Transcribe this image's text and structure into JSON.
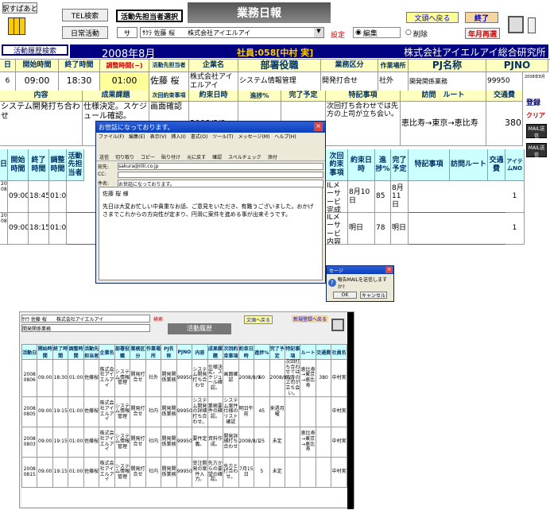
{
  "toolbar": {
    "station_label": "駅すぱあと",
    "tel_search": "TEL検索",
    "assign_select": "活動先担当者選択",
    "title": "業務日報",
    "doc_back": "文頭へ戻る",
    "end": "終了",
    "daily": "日常活動",
    "sa": "サ",
    "customer": "ｻｸﾗ 佐藤 桜　　株式会社アイエルアイ",
    "settings": "設定",
    "edit": "編集",
    "delete": "削除",
    "year_month_reset": "年月再選",
    "history_search": "活動履歴検索"
  },
  "banner": {
    "month": "2008年8月",
    "employee": "社員:058[中村 実]",
    "company": "株式会社アイエルアイ総合研究所"
  },
  "head_row": {
    "labels": [
      "日",
      "開始時間",
      "終了時間",
      "調整時間(−)",
      "活動先担当者",
      "企業名",
      "部署役職",
      "業務区分",
      "作業場所",
      "PJ名称",
      "PJNO"
    ],
    "values": [
      "6",
      "09:00",
      "18:30",
      "01:00",
      "佐藤 桜",
      "株式会社アイエルアイ",
      "システム情報管理",
      "開発打合せ",
      "社外",
      "開発関係業務",
      "99950"
    ],
    "side": "2008年8月"
  },
  "detail_row": {
    "labels": [
      "内容",
      "成果課題",
      "次回約束事項",
      "約束日時",
      "進捗%",
      "完了予定",
      "特記事項",
      "訪問　ルート",
      "交通費"
    ],
    "content": "システム開発打ち合わせ",
    "result": "仕様決定。スケジュール確認。",
    "next_promise": "画面確認",
    "promise_date": "2008/8/9",
    "note": "次回打ち合わせでは先方の上司が立ち会い。",
    "route": "恵比寿→東京→恵比寿",
    "fare": "380"
  },
  "side_buttons": [
    "登録",
    "クリア",
    "MAIL送信",
    "MAIL送信"
  ],
  "lower_table": {
    "headers": [
      "日",
      "開始時間",
      "終了時間",
      "調整時間",
      "活動先担当者",
      "次回約束事項",
      "約束日時",
      "進捗%",
      "完了予定",
      "特記事項",
      "訪問ルート",
      "交通費",
      "アイテムNO"
    ],
    "rows": [
      {
        "date": "2008 0805",
        "start": "09:00",
        "end": "18:45",
        "adj": "01:00",
        "next": "ILメーサービ完成",
        "promise": "8月10日",
        "progress": "85",
        "done": "8月11日",
        "item": "1"
      },
      {
        "date": "2008 0804",
        "start": "09:00",
        "end": "18:15",
        "adj": "01:00",
        "next": "ILメーサービ内容確認",
        "promise": "明日",
        "progress": "78",
        "done": "明日",
        "item": "1"
      }
    ]
  },
  "mail": {
    "title": "お世話になっております。",
    "menu": [
      "ファイル(F)",
      "編集(E)",
      "表示(V)",
      "挿入(I)",
      "書式(O)",
      "ツール(T)",
      "メッセージ(M)",
      "ヘルプ(H)"
    ],
    "tools": [
      "送信",
      "切り取り",
      "コピー",
      "貼り付け",
      "元に戻す",
      "確認",
      "スペルチェック",
      "添付"
    ],
    "to_label": "宛先:",
    "to": "sakura@ilili.co.jp",
    "cc_label": "CC:",
    "subject_label": "件名:",
    "subject": "お世話になっております。",
    "body_name": "佐藤 桜 様",
    "body_text": "先日は大変お忙しい中貴重なお話、ご意見をいただき、有難うございました。おかげさまでこれからの方向性が定まり、円滑に案件を進める事が出来そうです。"
  },
  "dialog": {
    "title": "セージ",
    "question": "報告MAILを送信しますか?",
    "ok": "OK",
    "cancel": "キャンセル"
  },
  "history": {
    "customer": "ｻｸﾗ 佐藤 桜　　株式会社アイエルアイ",
    "project": "開発関係業務",
    "search": "検索",
    "title": "活動履歴",
    "doc_back": "文頭へ戻る",
    "new": "新規登録へ戻る",
    "headers": [
      "活動日",
      "開始時間",
      "終了時間",
      "調整時間",
      "活動先担当者",
      "企業名",
      "部署役職",
      "業務区分",
      "作業場所",
      "PJ名称",
      "PJNO",
      "内容",
      "成果課題",
      "次回約束事項",
      "約束日時",
      "進捗%",
      "完了予定",
      "特記事項",
      "ルート",
      "交通費",
      "社員名"
    ],
    "rows": [
      [
        "2008 0806",
        "09:00",
        "18:30",
        "01:00",
        "佐藤桜",
        "株式会社アイエルアイ",
        "システム情報管理",
        "開発打合せ",
        "社外",
        "開発関係業務",
        "99950",
        "システム開発打ち合わせ",
        "仕様決定。スケジュール確認。",
        "画面確認",
        "2008/8/9",
        "60",
        "2008/8/20",
        "次回打ち合わせでは先方の上司が立ち会い。",
        "恵比寿→東京→恵比寿",
        "380",
        "中村実"
      ],
      [
        "2008 0805",
        "09:00",
        "19:15",
        "01:00",
        "佐藤桜",
        "株式会社アイエルアイ",
        "システム情報管理",
        "開発打合せ",
        "社内",
        "開発関係業務",
        "99950",
        "システム開発の詳細打ち合わせ。",
        "業務要件の確認。",
        "システム案件仕様のリスト確認",
        "明日午前",
        "45",
        "来週月曜",
        "",
        "",
        "",
        "中村実"
      ],
      [
        "2008 0803",
        "09:00",
        "19:15",
        "01:00",
        "佐藤桜",
        "株式会社アイエルアイ",
        "システム情報管理",
        "開発打合せ",
        "社内",
        "開発関係業務",
        "99950",
        "要件定義。",
        "資料作成。",
        "開発詳細打ち合わせ",
        "2008/8/1",
        "25",
        "未定",
        "",
        "恵比寿→東京→恵比寿",
        "",
        "中村実"
      ],
      [
        "2008 0815",
        "09:00",
        "19:15",
        "01:00",
        "佐藤桜",
        "株式会社アイエルアイ",
        "システム情報管理",
        "開発打合せ",
        "社内",
        "開発関係業務",
        "99950",
        "受注開発の案件入力。",
        "先方からの要望の確認。",
        "先方と打合わせ。",
        "7月15日",
        "5",
        "未定",
        "",
        "",
        "",
        "中村実"
      ]
    ]
  },
  "colors": {
    "banner": "#000080",
    "gold": "#ffcc00",
    "header": "#ffffc0",
    "accent": "#ff99cc"
  }
}
